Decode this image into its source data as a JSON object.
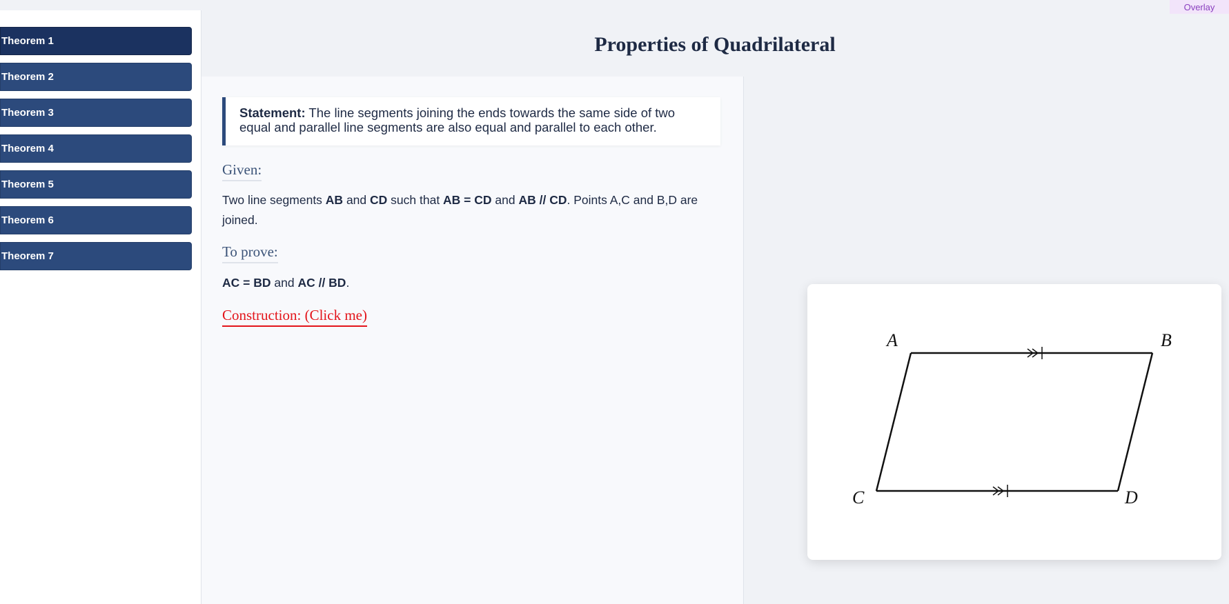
{
  "overlay_label": "Overlay",
  "sidebar": {
    "items": [
      {
        "label": "Theorem 1",
        "active": true
      },
      {
        "label": "Theorem 2"
      },
      {
        "label": "Theorem 3"
      },
      {
        "label": "Theorem 4"
      },
      {
        "label": "Theorem 5"
      },
      {
        "label": "Theorem 6"
      },
      {
        "label": "Theorem 7"
      }
    ]
  },
  "page_title": "Properties of Quadrilateral",
  "statement": {
    "label": "Statement:",
    "text": "The line segments joining the ends towards the same side of two equal and parallel line segments are also equal and parallel to each other."
  },
  "given": {
    "heading": "Given:",
    "parts": [
      {
        "t": "Two line segments ",
        "b": false
      },
      {
        "t": "AB",
        "b": true
      },
      {
        "t": " and ",
        "b": false
      },
      {
        "t": "CD",
        "b": true
      },
      {
        "t": " such that ",
        "b": false
      },
      {
        "t": "AB = CD",
        "b": true
      },
      {
        "t": " and ",
        "b": false
      },
      {
        "t": "AB // CD",
        "b": true
      },
      {
        "t": ". Points A,C and B,D are joined.",
        "b": false
      }
    ]
  },
  "to_prove": {
    "heading": "To prove:",
    "parts": [
      {
        "t": "AC = BD",
        "b": true
      },
      {
        "t": " and ",
        "b": false
      },
      {
        "t": "AC // BD",
        "b": true
      },
      {
        "t": ".",
        "b": false
      }
    ]
  },
  "construction_link": "Construction: (Click me)",
  "diagram": {
    "labels": {
      "A": "A",
      "B": "B",
      "C": "C",
      "D": "D"
    },
    "stroke_color": "#111111"
  }
}
